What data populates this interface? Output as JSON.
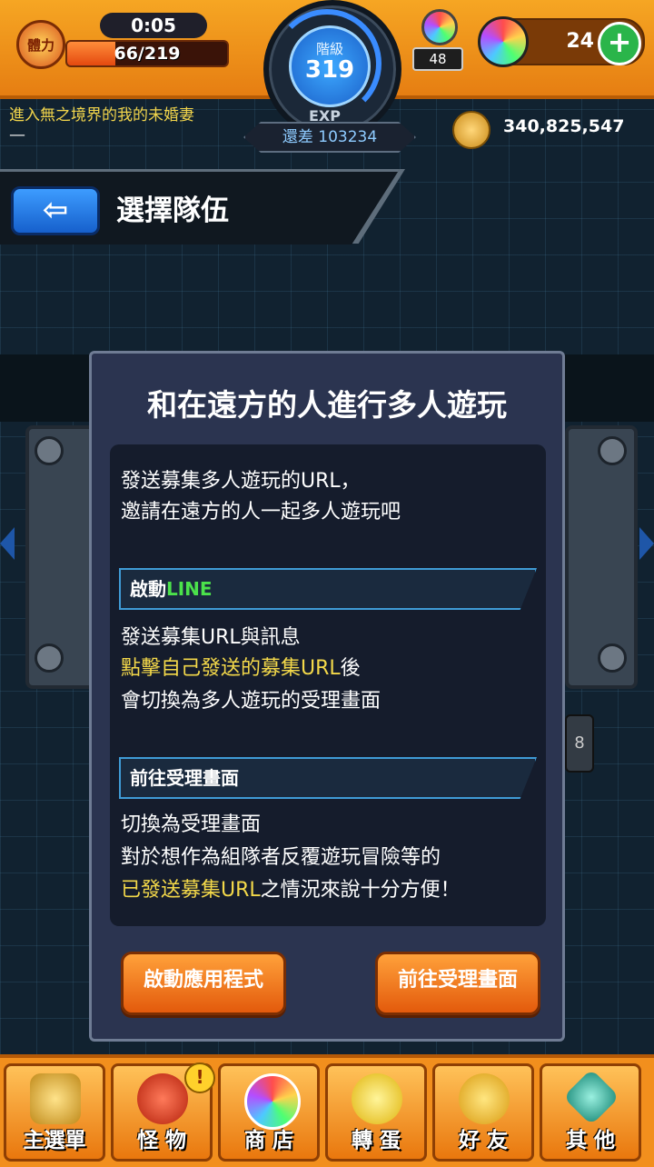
{
  "status": {
    "stamina_label": "體力",
    "stamina_timer": "0:05",
    "stamina_value": "66/219",
    "stamina_fraction": 0.3,
    "rank_label": "階級",
    "rank_value": "319",
    "exp_label": "EXP",
    "exp_remaining": "還差 103234",
    "orb_count": "48",
    "gem_count": "24",
    "gem_plus": "+",
    "quest_title": "進入無之境界的我的未婚妻",
    "quest_sub": "—",
    "coins": "340,825,547"
  },
  "header": {
    "back_glyph": "⇦",
    "title": "選擇隊伍"
  },
  "background": {
    "side_badge": "8"
  },
  "dialog": {
    "title": "和在遠方的人進行多人遊玩",
    "intro": [
      "發送募集多人遊玩的URL，",
      "邀請在遠方的人一起多人遊玩吧"
    ],
    "section1": {
      "label_prefix": "啟動",
      "label_highlight": "LINE",
      "line1": "發送募集URL與訊息",
      "line2_highlight": "點擊自己發送的募集URL",
      "line2_rest": "後",
      "line3": "會切換為多人遊玩的受理畫面"
    },
    "section2": {
      "label": "前往受理畫面",
      "line1": "切換為受理畫面",
      "line2": "對於想作為組隊者反覆遊玩冒險等的",
      "line3_highlight": "已發送募集URL",
      "line3_rest": "之情況來說十分方便！"
    },
    "buttons": {
      "launch_app": "啟動應用程式",
      "go_reception": "前往受理畫面"
    }
  },
  "nav": {
    "items": [
      {
        "label": "主選單",
        "icon": "gate-icon"
      },
      {
        "label": "怪 物",
        "icon": "monster-icon",
        "badge": "!"
      },
      {
        "label": "商 店",
        "icon": "orb-icon"
      },
      {
        "label": "轉 蛋",
        "icon": "egg-icon"
      },
      {
        "label": "好 友",
        "icon": "friends-icon"
      },
      {
        "label": "其 他",
        "icon": "other-icon"
      }
    ]
  },
  "colors": {
    "accent_orange": "#f28f1d",
    "dialog_bg": "#2b3450",
    "highlight_yellow": "#f4d94a",
    "line_green": "#4be24b",
    "back_blue": "#1660cc"
  }
}
